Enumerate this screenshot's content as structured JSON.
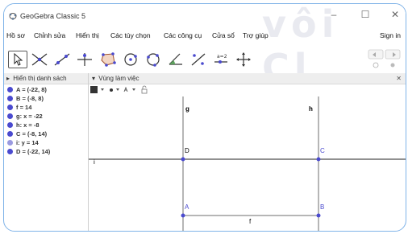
{
  "window": {
    "title": "GeoGebra Classic 5",
    "controls": {
      "minimize": "–",
      "maximize": "☐",
      "close": "✕"
    },
    "watermark": "vôi Cl"
  },
  "menubar": {
    "items": [
      "Hồ sơ",
      "Chỉnh sửa",
      "Hiển thị",
      "Các tùy chọn",
      "Các công cụ",
      "Cửa sổ",
      "Trợ giúp"
    ],
    "sign_in": "Sign in"
  },
  "toolbar": {
    "tools": [
      "move-icon",
      "line-icon",
      "ray-icon",
      "perpendicular-icon",
      "polygon-icon",
      "circle-icon",
      "circle-3points-icon",
      "angle-icon",
      "reflect-icon",
      "slider-icon",
      "move-view-icon"
    ],
    "selected_index": 0
  },
  "algebra": {
    "header": "Hiển thị danh sách",
    "items": [
      {
        "text": "A = (-22, 8)",
        "color": "#4a4acf"
      },
      {
        "text": "B = (-8, 8)",
        "color": "#4a4acf"
      },
      {
        "text": "f = 14",
        "color": "#4a4acf"
      },
      {
        "text": "g: x = -22",
        "color": "#4a4acf"
      },
      {
        "text": "h: x = -8",
        "color": "#4a4acf"
      },
      {
        "text": "C = (-8, 14)",
        "color": "#4a4acf"
      },
      {
        "text": "i: y = 14",
        "color": "#9a9ae0"
      },
      {
        "text": "D = (-22, 14)",
        "color": "#4a4acf"
      }
    ]
  },
  "graphics": {
    "header": "Vùng làm việc",
    "labels": {
      "g": "g",
      "h": "h",
      "i": "i",
      "f": "f",
      "A": "A",
      "B": "B",
      "C": "C",
      "D": "D"
    },
    "style_bar": {
      "font_size_label": "A"
    }
  },
  "colors": {
    "point": "#4a4acf",
    "point_alt": "#9a9ae0",
    "line": "#6e6e6e",
    "axis": "#222222",
    "header_bg": "#eeeeee"
  }
}
